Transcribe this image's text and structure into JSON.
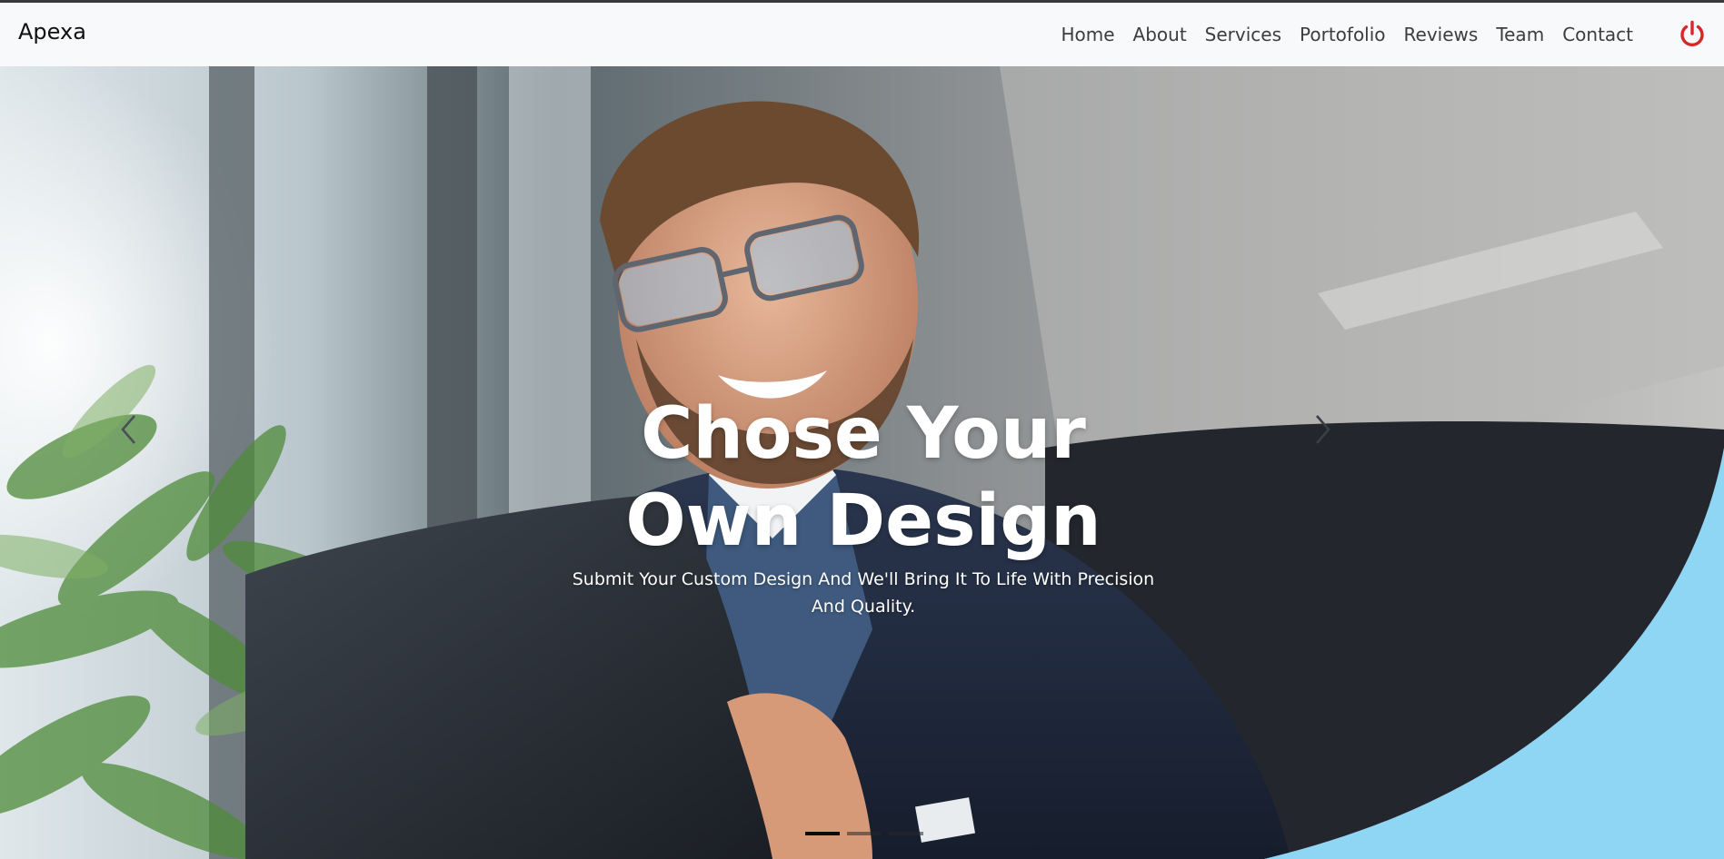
{
  "navbar": {
    "brand": "Apexa",
    "links": [
      {
        "label": "Home"
      },
      {
        "label": "About"
      },
      {
        "label": "Services"
      },
      {
        "label": "Portofolio"
      },
      {
        "label": "Reviews"
      },
      {
        "label": "Team"
      },
      {
        "label": "Contact"
      }
    ],
    "power_icon": "power-icon",
    "power_color": "#d62828"
  },
  "hero": {
    "headline": "Chose Your Own Design",
    "subtitle": "Submit Your Custom Design And We'll Bring It To Life With Precision And Quality.",
    "accent_color": "#8fd6f5",
    "prev_icon": "chevron-left-icon",
    "next_icon": "chevron-right-icon",
    "indicators": {
      "count": 3,
      "active": 1
    }
  }
}
